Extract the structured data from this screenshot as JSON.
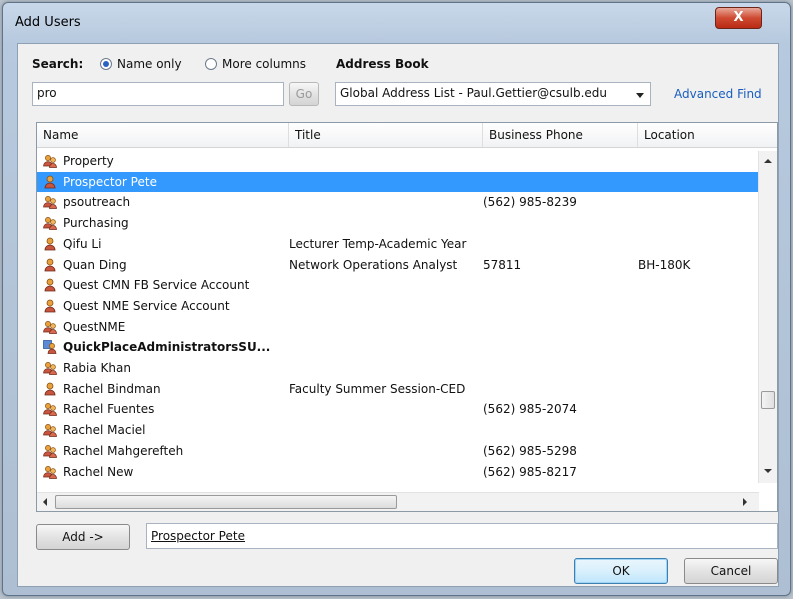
{
  "window": {
    "title": "Add Users",
    "close_label": "X"
  },
  "search": {
    "label": "Search:",
    "options": [
      {
        "label": "Name only",
        "selected": true
      },
      {
        "label": "More columns",
        "selected": false
      }
    ],
    "value": "pro",
    "go_label": "Go"
  },
  "address_book": {
    "label": "Address Book",
    "selected": "Global Address List - Paul.Gettier@csulb.edu",
    "advanced_find": "Advanced Find"
  },
  "columns": [
    "Name",
    "Title",
    "Business Phone",
    "Location"
  ],
  "rows": [
    {
      "icon": "group",
      "name": "Property",
      "title": "",
      "phone": "",
      "location": "",
      "selected": false,
      "bold": false
    },
    {
      "icon": "user",
      "name": "Prospector Pete",
      "title": "",
      "phone": "",
      "location": "",
      "selected": true,
      "bold": false
    },
    {
      "icon": "group",
      "name": "psoutreach",
      "title": "",
      "phone": "(562) 985-8239",
      "location": "",
      "selected": false,
      "bold": false
    },
    {
      "icon": "group",
      "name": "Purchasing",
      "title": "",
      "phone": "",
      "location": "",
      "selected": false,
      "bold": false
    },
    {
      "icon": "user",
      "name": "Qifu Li",
      "title": "Lecturer Temp-Academic Year",
      "phone": "",
      "location": "",
      "selected": false,
      "bold": false
    },
    {
      "icon": "user",
      "name": "Quan Ding",
      "title": "Network Operations Analyst",
      "phone": "57811",
      "location": "BH-180K",
      "selected": false,
      "bold": false
    },
    {
      "icon": "user",
      "name": "Quest CMN FB Service Account",
      "title": "",
      "phone": "",
      "location": "",
      "selected": false,
      "bold": false
    },
    {
      "icon": "user",
      "name": "Quest NME Service Account",
      "title": "",
      "phone": "",
      "location": "",
      "selected": false,
      "bold": false
    },
    {
      "icon": "group",
      "name": "QuestNME",
      "title": "",
      "phone": "",
      "location": "",
      "selected": false,
      "bold": false
    },
    {
      "icon": "distlist",
      "name": "QuickPlaceAdministratorsSU...",
      "title": "",
      "phone": "",
      "location": "",
      "selected": false,
      "bold": true
    },
    {
      "icon": "group",
      "name": "Rabia Khan",
      "title": "",
      "phone": "",
      "location": "",
      "selected": false,
      "bold": false
    },
    {
      "icon": "user",
      "name": "Rachel Bindman",
      "title": "Faculty Summer Session-CED",
      "phone": "",
      "location": "",
      "selected": false,
      "bold": false
    },
    {
      "icon": "group",
      "name": "Rachel Fuentes",
      "title": "",
      "phone": "(562) 985-2074",
      "location": "",
      "selected": false,
      "bold": false
    },
    {
      "icon": "group",
      "name": "Rachel Maciel",
      "title": "",
      "phone": "",
      "location": "",
      "selected": false,
      "bold": false
    },
    {
      "icon": "group",
      "name": "Rachel Mahgerefteh",
      "title": "",
      "phone": "(562) 985-5298",
      "location": "",
      "selected": false,
      "bold": false
    },
    {
      "icon": "group",
      "name": "Rachel New",
      "title": "",
      "phone": "(562) 985-8217",
      "location": "",
      "selected": false,
      "bold": false
    }
  ],
  "add": {
    "button_label": "Add ->",
    "value": "Prospector Pete"
  },
  "buttons": {
    "ok": "OK",
    "cancel": "Cancel"
  },
  "colors": {
    "selection": "#3399ff",
    "link": "#1a5dbf",
    "close": "#cf4a31"
  }
}
